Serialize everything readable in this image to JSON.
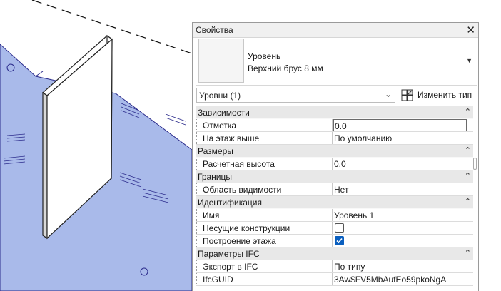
{
  "palette": {
    "title": "Свойства",
    "close_icon": "close-icon"
  },
  "type_selector": {
    "family": "Уровень",
    "type_name": "Верхний брус 8 мм"
  },
  "instance_filter": {
    "label": "Уровни (1)"
  },
  "edit_type": {
    "label": "Изменить тип"
  },
  "groups": {
    "constraints": {
      "label": "Зависимости",
      "elevation": {
        "name": "Отметка",
        "value": "0.0"
      },
      "story_above": {
        "name": "На этаж выше",
        "value": "По умолчанию"
      }
    },
    "dimensions": {
      "label": "Размеры",
      "computation_height": {
        "name": "Расчетная высота",
        "value": "0.0"
      }
    },
    "extents": {
      "label": "Границы",
      "scope_box": {
        "name": "Область видимости",
        "value": "Нет"
      }
    },
    "identity": {
      "label": "Идентификация",
      "name": {
        "name": "Имя",
        "value": "Уровень 1"
      },
      "structural": {
        "name": "Несущие конструкции",
        "checked": false
      },
      "building_story": {
        "name": "Построение этажа",
        "checked": true
      }
    },
    "ifc": {
      "label": "Параметры IFC",
      "export": {
        "name": "Экспорт в IFC",
        "value": "По типу"
      },
      "guid": {
        "name": "IfcGUID",
        "value": "3Aw$FV5MbAufEo59pkoNgA"
      }
    }
  },
  "colors": {
    "floor_plane": "#a9baea",
    "checkbox_accent": "#0a5fbf",
    "category_header": "#e8e8e8"
  }
}
